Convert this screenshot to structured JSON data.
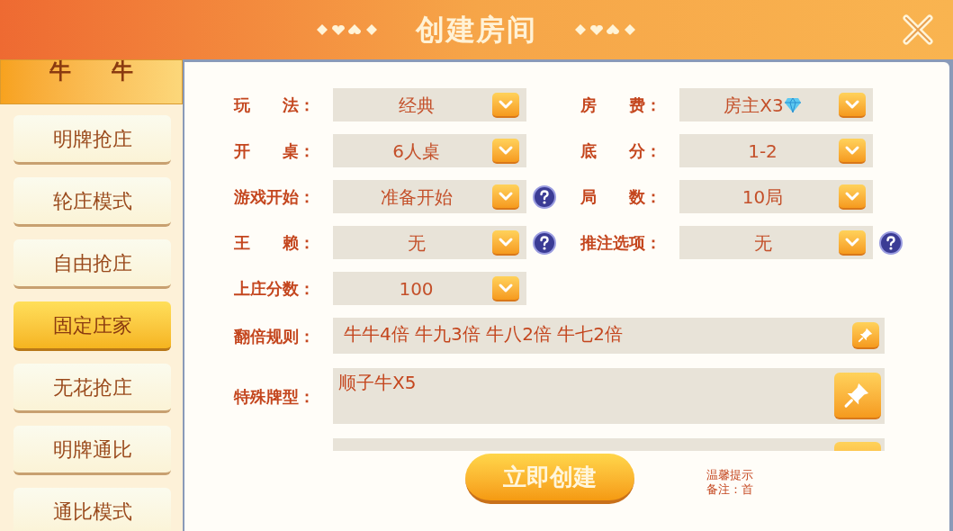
{
  "title": "创建房间",
  "sidebar": {
    "header": [
      "牛",
      "牛"
    ],
    "modes": [
      {
        "label": "明牌抢庄",
        "selected": false
      },
      {
        "label": "轮庄模式",
        "selected": false
      },
      {
        "label": "自由抢庄",
        "selected": false
      },
      {
        "label": "固定庄家",
        "selected": true
      },
      {
        "label": "无花抢庄",
        "selected": false
      },
      {
        "label": "明牌通比",
        "selected": false
      },
      {
        "label": "通比模式",
        "selected": false
      }
    ]
  },
  "left_settings": [
    {
      "label": "玩　　法：",
      "value": "经典",
      "help": false,
      "diamond": false
    },
    {
      "label": "开　　桌：",
      "value": "6人桌",
      "help": false,
      "diamond": false
    },
    {
      "label": "游戏开始：",
      "value": "准备开始",
      "help": true,
      "diamond": false
    },
    {
      "label": "王　　赖：",
      "value": "无",
      "help": true,
      "diamond": false
    },
    {
      "label": "上庄分数：",
      "value": "100",
      "help": false,
      "diamond": false
    }
  ],
  "right_settings": [
    {
      "label": "房　　费：",
      "value": "房主X3",
      "help": false,
      "diamond": true
    },
    {
      "label": "底　　分：",
      "value": "1-2",
      "help": false,
      "diamond": false
    },
    {
      "label": "局　　数：",
      "value": "10局",
      "help": false,
      "diamond": false
    },
    {
      "label": "推注选项：",
      "value": "无",
      "help": true,
      "diamond": false
    }
  ],
  "rule_fields": [
    {
      "kind": "short",
      "label": "翻倍规则：",
      "value": "牛牛4倍 牛九3倍 牛八2倍 牛七2倍"
    },
    {
      "kind": "tall",
      "label": "特殊牌型：",
      "value": "顺子牛X5"
    },
    {
      "kind": "cut"
    }
  ],
  "create_button": "立即创建",
  "tips": [
    "温馨提示",
    "备注：首"
  ]
}
